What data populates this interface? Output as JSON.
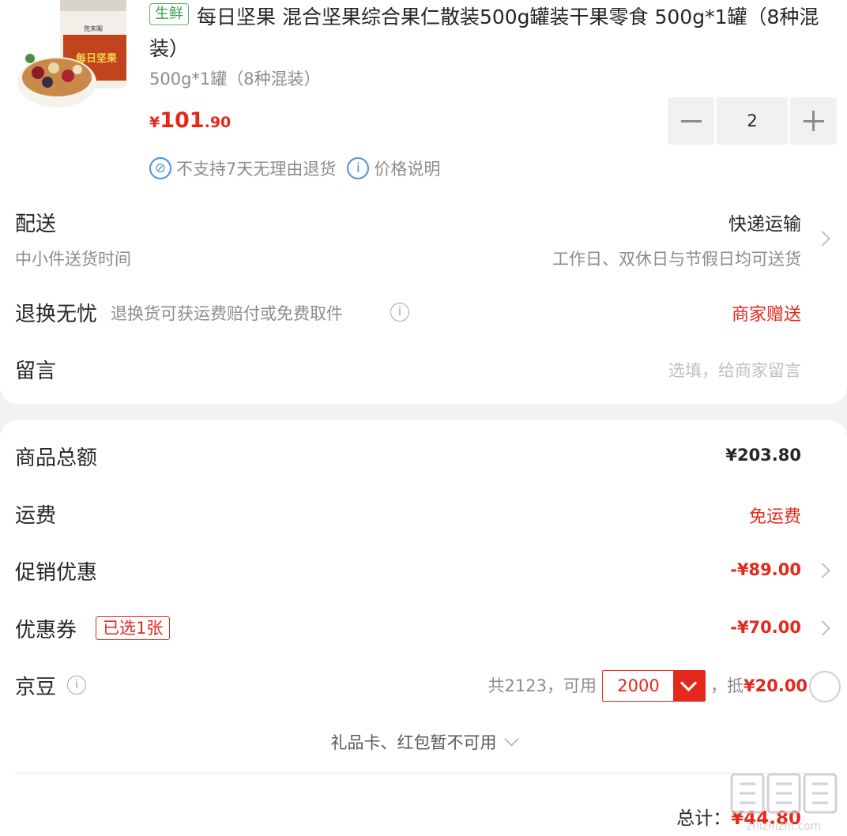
{
  "product": {
    "tag": "生鲜",
    "title": "每日坚果 混合坚果综合果仁散装500g罐装干果零食 500g*1罐（8种混装）",
    "spec": "500g*1罐（8种混装）",
    "price_symbol": "¥",
    "price_int": "101",
    "price_dec": ".90",
    "quantity": "2",
    "no_return_note": "不支持7天无理由退货",
    "price_note": "价格说明",
    "image_label_brand": "兜末暇",
    "image_label_name": "每日坚果"
  },
  "delivery": {
    "label": "配送",
    "sub": "中小件送货时间",
    "method": "快递运输",
    "schedule": "工作日、双休日与节假日均可送货"
  },
  "return_service": {
    "label": "退换无忧",
    "desc": "退换货可获运费赔付或免费取件",
    "value": "商家赠送"
  },
  "message": {
    "label": "留言",
    "placeholder": "选填，给商家留言"
  },
  "summary": {
    "goods_total_label": "商品总额",
    "goods_total": "¥203.80",
    "shipping_label": "运费",
    "shipping": "免运费",
    "promo_label": "促销优惠",
    "promo": "-¥89.00",
    "coupon_label": "优惠券",
    "coupon_badge": "已选1张",
    "coupon": "-¥70.00",
    "beans_label": "京豆",
    "beans_info": "共2123，可用",
    "beans_value": "2000",
    "beans_deduct": "，抵¥20.00",
    "gift_note": "礼品卡、红包暂不可用",
    "total_label": "总计：",
    "total": "¥44.80"
  },
  "watermark": "值 什么值得买 zhizhizhi.com",
  "colors": {
    "accent_red": "#e4281c",
    "fresh_green": "#3aa24e",
    "info_blue": "#4a90e2",
    "background": "#f2f2f2"
  }
}
